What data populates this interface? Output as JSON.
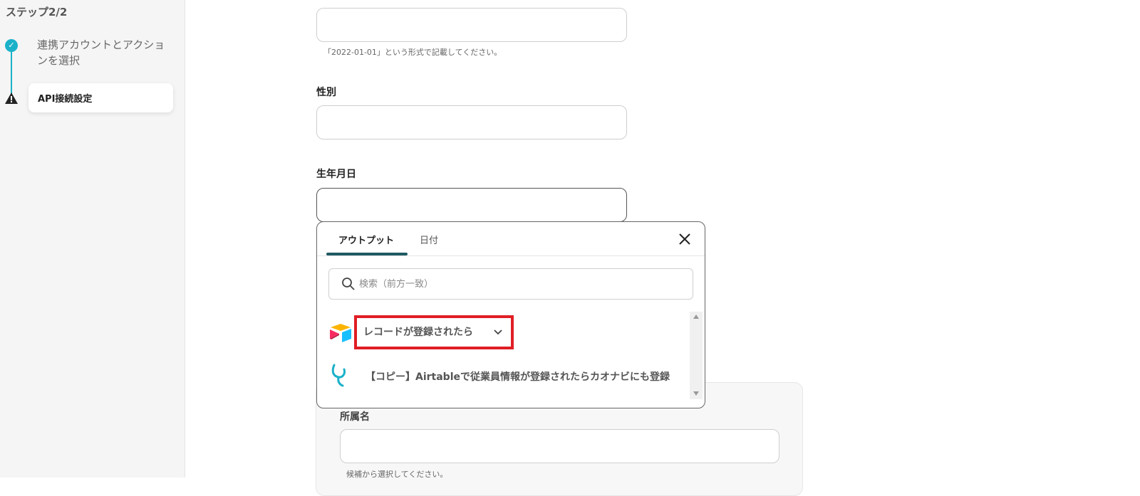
{
  "sidebar": {
    "step_title": "ステップ2/2",
    "steps": [
      {
        "label": "連携アカウントとアクションを選択",
        "status": "done"
      },
      {
        "label": "API接続設定",
        "status": "warning"
      }
    ]
  },
  "form": {
    "date_helper": "「2022-01-01」という形式で記載してください。",
    "gender_label": "性別",
    "birthdate_label": "生年月日",
    "group": {
      "affiliation_label": "所属名",
      "affiliation_helper": "候補から選択してください。"
    }
  },
  "popup": {
    "tabs": [
      {
        "label": "アウトプット",
        "active": true
      },
      {
        "label": "日付",
        "active": false
      }
    ],
    "search_placeholder": "検索（前方一致）",
    "items": [
      {
        "label": "レコードが登録されたら",
        "icon": "airtable-icon",
        "expandable": true
      },
      {
        "label": "【コピー】Airtableで従業員情報が登録されたらカオナビにも登録",
        "icon": "yoom-icon"
      }
    ]
  },
  "colors": {
    "accent": "#1bb1c9",
    "tab_underline": "#1f5a63",
    "highlight": "#e01e24"
  }
}
